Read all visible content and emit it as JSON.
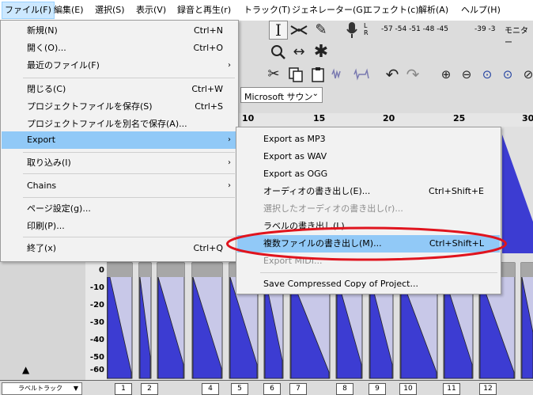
{
  "menubar": {
    "items": [
      {
        "label": "ファイル(F)"
      },
      {
        "label": "編集(E)"
      },
      {
        "label": "選択(S)"
      },
      {
        "label": "表示(V)"
      },
      {
        "label": "録音と再生(r)"
      },
      {
        "label": "トラック(T)"
      },
      {
        "label": "ジェネレーター(G)"
      },
      {
        "label": "エフェクト(c)"
      },
      {
        "label": "解析(A)"
      },
      {
        "label": "ヘルプ(H)"
      }
    ]
  },
  "meter": {
    "channel_l": "L",
    "channel_r": "R",
    "scale": "-57 -54 -51 -48 -45",
    "scale2": "-39 -3",
    "monitor_label": "モニター"
  },
  "device": {
    "selected": "Microsoft サウン"
  },
  "ruler": {
    "labels": [
      "10",
      "15",
      "20",
      "25",
      "30"
    ]
  },
  "vertical_scale": {
    "labels": [
      "0",
      "-10",
      "-20",
      "-30",
      "-40",
      "-50",
      "-60"
    ]
  },
  "label_track": {
    "name": "ラベルトラック",
    "labels": [
      "1",
      "2",
      "4",
      "5",
      "6",
      "7",
      "8",
      "9",
      "10",
      "11",
      "12"
    ]
  },
  "file_menu": {
    "items": [
      {
        "label": "新規(N)",
        "shortcut": "Ctrl+N"
      },
      {
        "label": "開く(O)...",
        "shortcut": "Ctrl+O"
      },
      {
        "label": "最近のファイル(F)",
        "arrow": "›"
      },
      {
        "label": "閉じる(C)",
        "shortcut": "Ctrl+W"
      },
      {
        "label": "プロジェクトファイルを保存(S)",
        "shortcut": "Ctrl+S"
      },
      {
        "label": "プロジェクトファイルを別名で保存(A)..."
      },
      {
        "label": "Export",
        "arrow": "›",
        "highlighted": true
      },
      {
        "label": "取り込み(I)",
        "arrow": "›"
      },
      {
        "label": "Chains",
        "arrow": "›"
      },
      {
        "label": "ページ設定(g)..."
      },
      {
        "label": "印刷(P)..."
      },
      {
        "label": "終了(x)",
        "shortcut": "Ctrl+Q"
      }
    ]
  },
  "export_menu": {
    "items": [
      {
        "label": "Export as MP3"
      },
      {
        "label": "Export as WAV"
      },
      {
        "label": "Export as OGG"
      },
      {
        "label": "オーディオの書き出し(E)...",
        "shortcut": "Ctrl+Shift+E"
      },
      {
        "label": "選択したオーディオの書き出し(r)...",
        "disabled": true
      },
      {
        "label": "ラベルの書き出し(L)..."
      },
      {
        "label": "複数ファイルの書き出し(M)...",
        "shortcut": "Ctrl+Shift+L",
        "highlighted": true
      },
      {
        "label": "Export MIDI...",
        "disabled": true
      },
      {
        "label": "Save Compressed Copy of Project..."
      }
    ]
  },
  "colors": {
    "highlight": "#91c9f7",
    "waveform": "#3c3cd2",
    "annotation": "#e0141e"
  }
}
